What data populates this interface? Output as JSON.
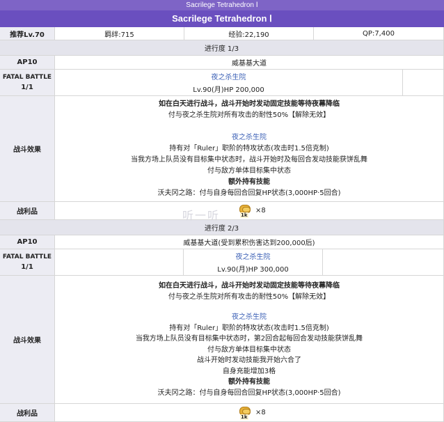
{
  "header": {
    "small_title": "Sacrilege Tetrahedron Ⅰ",
    "title": "Sacrilege Tetrahedron Ⅰ"
  },
  "stats": {
    "level": "推荐Lv.70",
    "bond": "羁绊:715",
    "exp": "经验:22,190",
    "qp": "QP:7,400"
  },
  "watermark": "听一听",
  "labels": {
    "ap": "AP10",
    "fatal": "FATAL BATTLE",
    "fatal_count": "1/1",
    "effect": "战斗效果",
    "drop": "战利品"
  },
  "stage1": {
    "progress": "进行度 1/3",
    "location": "威基基大道",
    "enemy_name": "夜之杀生院",
    "enemy_stats": "Lv.90(月)HP 200,000",
    "effects": [
      {
        "text": "如在白天进行战斗，战斗开始时发动固定技能等待夜幕降临",
        "bold": true
      },
      {
        "text": "付与夜之杀生院对所有攻击的耐性50%【解除无效】",
        "bold": false
      },
      {
        "text": "",
        "bold": false
      },
      {
        "text": "夜之杀生院",
        "bold": false,
        "blue": true
      },
      {
        "text": "持有对「Ruler」职阶的特攻状态(攻击时1.5倍克制)",
        "bold": false
      },
      {
        "text": "当我方场上队员没有目标集中状态时，战斗开始时及每回合发动技能获饼乱舞",
        "bold": false
      },
      {
        "text": "付与敌方单体目标集中状态",
        "bold": false
      },
      {
        "text": "额外持有技能",
        "bold": true
      },
      {
        "text": "沃夫冈之路：付与自身每回合回复HP状态(3,000HP·5回合)",
        "bold": false
      }
    ],
    "drop_tag": "1k",
    "drop_count": "×8"
  },
  "stage2": {
    "progress": "进行度 2/3",
    "location": "威基基大道(受到累积伤害达到200,000后)",
    "enemy_name": "夜之杀生院",
    "enemy_stats": "Lv.90(月)HP 300,000",
    "effects": [
      {
        "text": "如在白天进行战斗，战斗开始时发动固定技能等待夜幕降临",
        "bold": true
      },
      {
        "text": "付与夜之杀生院对所有攻击的耐性50%【解除无效】",
        "bold": false
      },
      {
        "text": "",
        "bold": false
      },
      {
        "text": "夜之杀生院",
        "bold": false,
        "blue": true
      },
      {
        "text": "持有对「Ruler」职阶的特攻状态(攻击时1.5倍克制)",
        "bold": false
      },
      {
        "text": "当我方场上队员没有目标集中状态时，第2回合起每回合发动技能获饼乱舞",
        "bold": false
      },
      {
        "text": "付与敌方单体目标集中状态",
        "bold": false
      },
      {
        "text": "战斗开始时发动技能我开始六合了",
        "bold": false
      },
      {
        "text": "自身充能增加3格",
        "bold": false
      },
      {
        "text": "额外持有技能",
        "bold": true
      },
      {
        "text": "沃夫冈之路：付与自身每回合回复HP状态(3,000HP·5回合)",
        "bold": false
      }
    ],
    "drop_tag": "1k",
    "drop_count": "×8"
  },
  "colors": {
    "header_bg": "#6a4fbf",
    "label_bg": "#ececf3",
    "link_blue": "#3a5fb5"
  }
}
